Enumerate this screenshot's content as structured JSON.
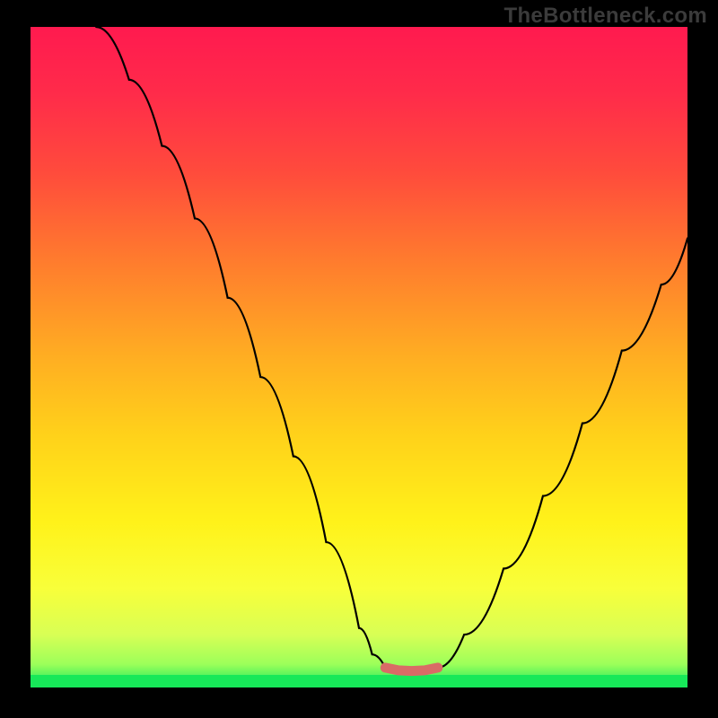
{
  "watermark": "TheBottleneck.com",
  "colors": {
    "frame": "#000000",
    "curve": "#000000",
    "optimal_segment": "#d96b66",
    "bottom_strip": "#17e859",
    "gradient_stops": [
      {
        "offset": 0.0,
        "color": "#ff1a4f"
      },
      {
        "offset": 0.1,
        "color": "#ff2b4a"
      },
      {
        "offset": 0.22,
        "color": "#ff4b3c"
      },
      {
        "offset": 0.35,
        "color": "#ff7a2e"
      },
      {
        "offset": 0.5,
        "color": "#ffae22"
      },
      {
        "offset": 0.62,
        "color": "#ffd21a"
      },
      {
        "offset": 0.75,
        "color": "#fff21a"
      },
      {
        "offset": 0.85,
        "color": "#f8ff3a"
      },
      {
        "offset": 0.92,
        "color": "#d8ff55"
      },
      {
        "offset": 0.965,
        "color": "#9cff5a"
      },
      {
        "offset": 0.985,
        "color": "#4bf25c"
      },
      {
        "offset": 1.0,
        "color": "#17e859"
      }
    ]
  },
  "chart_data": {
    "type": "line",
    "title": "",
    "xlabel": "",
    "ylabel": "",
    "xlim": [
      0,
      100
    ],
    "ylim": [
      0,
      100
    ],
    "series": [
      {
        "name": "left_curve",
        "x": [
          10,
          15,
          20,
          25,
          30,
          35,
          40,
          45,
          50,
          52,
          54
        ],
        "y": [
          100,
          92,
          82,
          71,
          59,
          47,
          35,
          22,
          9,
          5,
          3
        ]
      },
      {
        "name": "optimal_flat",
        "x": [
          54,
          56,
          58,
          60,
          62
        ],
        "y": [
          3,
          2.6,
          2.5,
          2.6,
          3
        ]
      },
      {
        "name": "right_curve",
        "x": [
          62,
          66,
          72,
          78,
          84,
          90,
          96,
          100
        ],
        "y": [
          3,
          8,
          18,
          29,
          40,
          51,
          61,
          68
        ]
      }
    ],
    "annotations": []
  }
}
